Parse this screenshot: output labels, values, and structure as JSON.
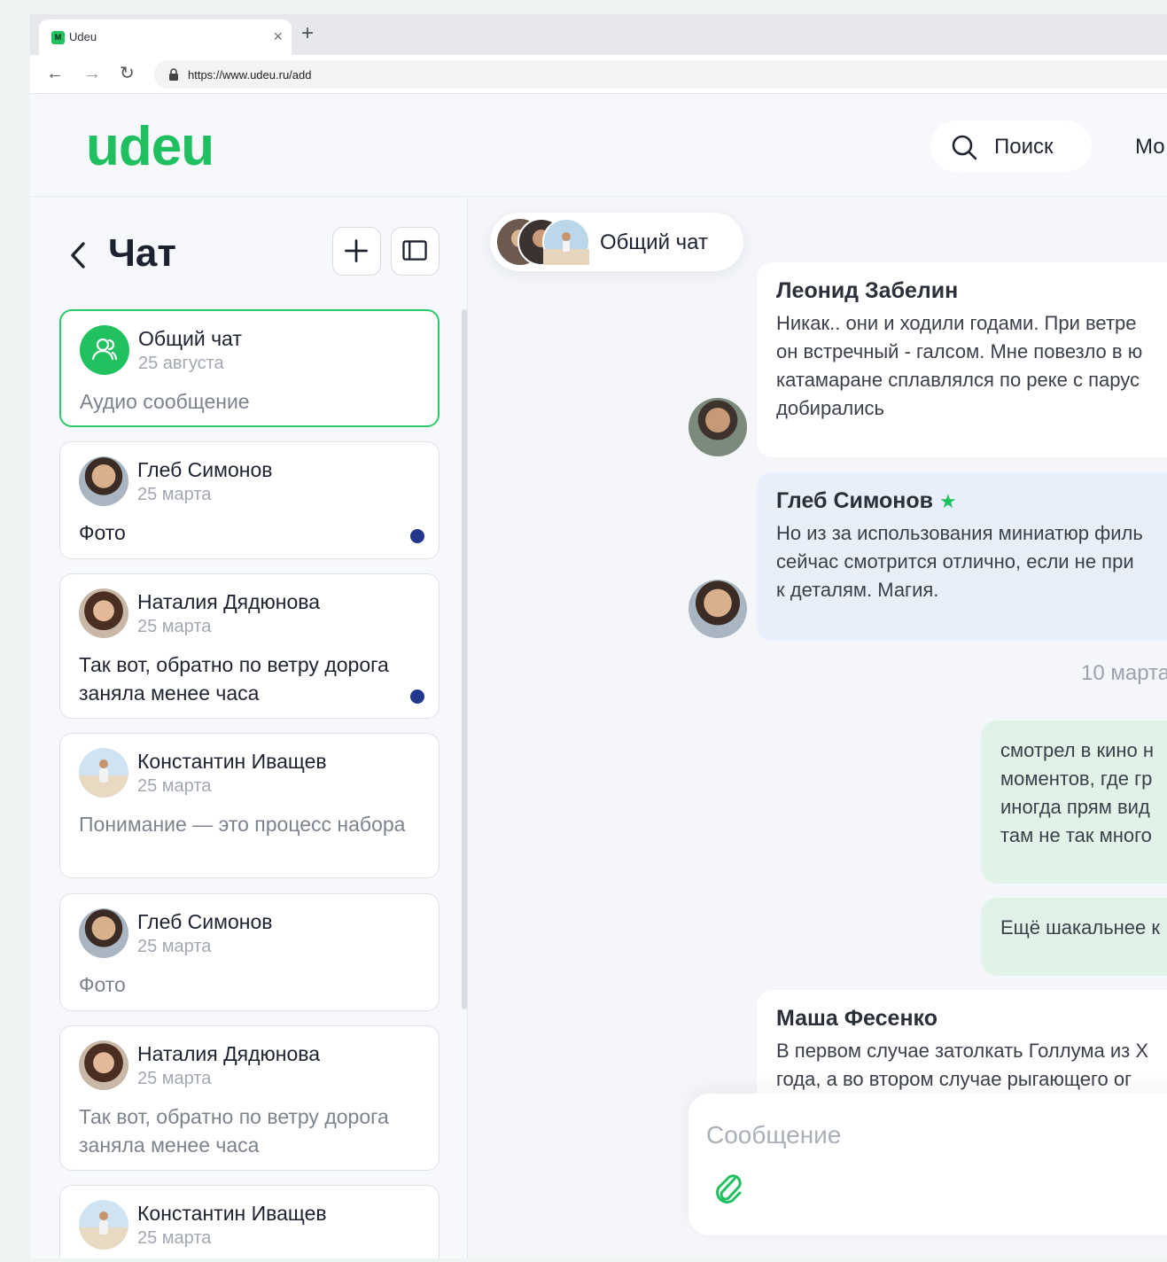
{
  "browser": {
    "tab_title": "Udeu",
    "tab_favicon_letter": "M",
    "tab_close": "×",
    "new_tab": "+",
    "url": "https://www.udeu.ru/add",
    "nav": {
      "back": "←",
      "forward": "→",
      "reload": "↻"
    }
  },
  "header": {
    "logo": "udeu",
    "search_label": "Поиск",
    "nav_partial": "Мо"
  },
  "sidebar": {
    "title": "Чат",
    "chats": [
      {
        "name": "Общий чат",
        "date": "25 августа",
        "preview": "Аудио сообщение",
        "unread": false,
        "active": true,
        "preview_muted": true
      },
      {
        "name": "Глеб Симонов",
        "date": "25 марта",
        "preview": "Фото",
        "unread": true,
        "active": false,
        "preview_muted": false
      },
      {
        "name": "Наталия Дядюнова",
        "date": "25 марта",
        "preview": "Так вот, обратно по ветру дорога заняла менее часа",
        "unread": true,
        "active": false,
        "preview_muted": false
      },
      {
        "name": "Константин Иващев",
        "date": "25 марта",
        "preview": "Понимание — это процесс набора",
        "unread": false,
        "active": false,
        "preview_muted": true
      },
      {
        "name": "Глеб Симонов",
        "date": "25 марта",
        "preview": "Фото",
        "unread": false,
        "active": false,
        "preview_muted": true
      },
      {
        "name": "Наталия Дядюнова",
        "date": "25 марта",
        "preview": "Так вот, обратно по ветру дорога заняла менее часа",
        "unread": false,
        "active": false,
        "preview_muted": true
      },
      {
        "name": "Константин Иващев",
        "date": "25 марта",
        "preview": "",
        "unread": false,
        "active": false,
        "preview_muted": true
      }
    ]
  },
  "chat": {
    "room_title": "Общий чат",
    "messages": [
      {
        "author": "Леонид Забелин",
        "lines": [
          "Никак.. они и ходили годами. При ветре",
          "он встречный - галсом. Мне повезло в ю",
          "катамаране сплавлялся по реке с парус",
          "добирались"
        ]
      },
      {
        "author": "Глеб Симонов",
        "star": "★",
        "lines": [
          "Но из за использования миниатюр филь",
          "сейчас смотрится отлично, если не при",
          "к деталям. Магия."
        ]
      }
    ],
    "date_separator": "10 марта",
    "my_messages": [
      {
        "lines": [
          "смотрел в кино н",
          "моментов, где гр",
          "иногда прям вид",
          "там не так много"
        ]
      },
      {
        "lines": [
          "Ещё шакальнее к"
        ]
      }
    ],
    "last_message": {
      "author": "Маша Фесенко",
      "lines": [
        "В первом случае затолкать Голлума из Х",
        "года, а во втором случае рыгающего ог"
      ]
    },
    "composer_placeholder": "Сообщение"
  },
  "colors": {
    "brand": "#20c060",
    "unread": "#22388c",
    "mine_bubble": "#e1f3e8",
    "tinted_bubble": "#e9effa"
  }
}
